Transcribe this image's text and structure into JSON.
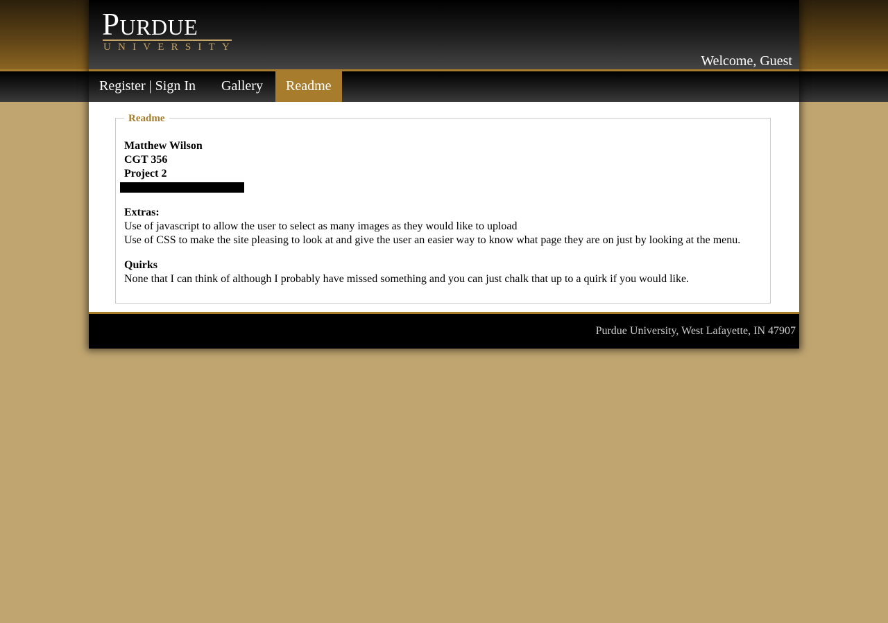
{
  "header": {
    "logo_word": "Purdue",
    "logo_subtitle": "UNIVERSITY",
    "welcome": "Welcome, Guest"
  },
  "nav": {
    "items": [
      {
        "label": "Register | Sign In"
      },
      {
        "label": "Gallery"
      },
      {
        "label": "Readme",
        "active": true
      }
    ]
  },
  "readme": {
    "legend": "Readme",
    "author": "Matthew Wilson",
    "course": "CGT 356",
    "project": "Project 2",
    "extras_heading": "Extras:",
    "extras_lines": [
      "Use of javascript to allow the user to select as many images as they would like to upload",
      "Use of CSS to make the site pleasing to look at and give the user an easier way to know what page they are on just by looking at the menu."
    ],
    "quirks_heading": "Quirks",
    "quirks_lines": [
      "None that I can think of although I probably have missed something and you can just chalk that up to a quirk if you would like."
    ]
  },
  "footer": {
    "address": "Purdue University, West Lafayette, IN 47907"
  },
  "colors": {
    "accent_gold": "#a77c2c",
    "page_background": "#c0a570",
    "logo_gold": "#c6a366"
  }
}
